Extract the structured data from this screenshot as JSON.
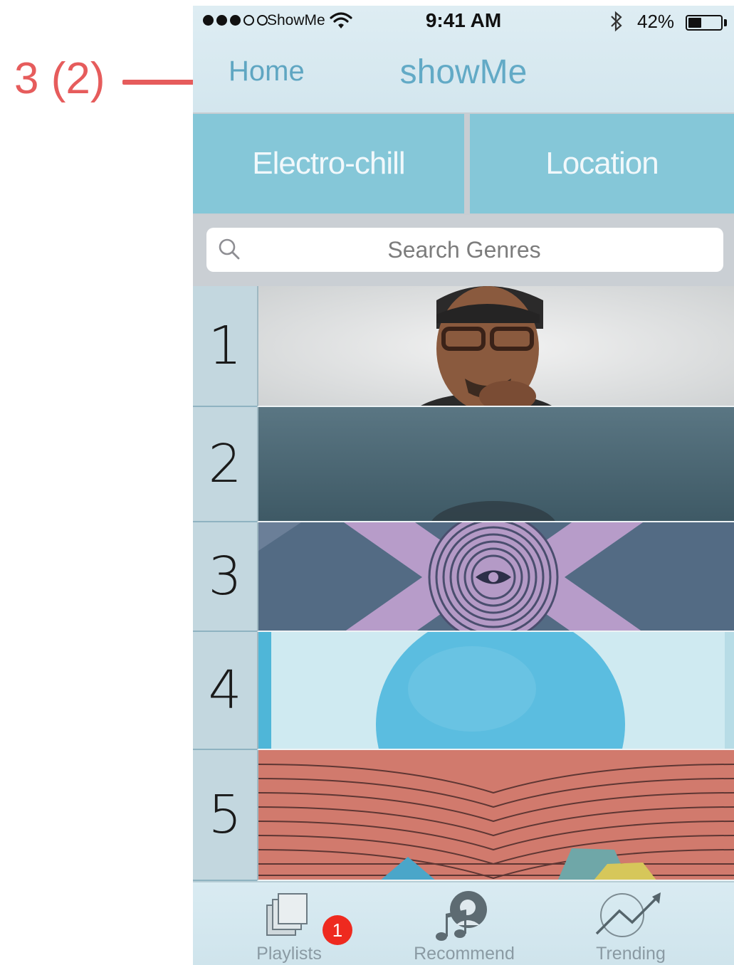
{
  "annotation": {
    "label": "3 (2)",
    "color": "#e65c5c"
  },
  "status_bar": {
    "carrier": "ShowMe",
    "time": "9:41 AM",
    "battery": "42%",
    "battery_level": 0.42
  },
  "nav": {
    "home_label": "Home",
    "title": "showMe"
  },
  "filters": [
    {
      "label": "Electro-chill"
    },
    {
      "label": "Location"
    }
  ],
  "search": {
    "placeholder": "Search Genres",
    "value": ""
  },
  "list": [
    {
      "rank": "1"
    },
    {
      "rank": "2"
    },
    {
      "rank": "3"
    },
    {
      "rank": "4"
    },
    {
      "rank": "5"
    }
  ],
  "tabs": [
    {
      "label": "Playlists",
      "icon": "playlists-icon",
      "badge": "1"
    },
    {
      "label": "Recommend",
      "icon": "recommend-icon"
    },
    {
      "label": "Trending",
      "icon": "trending-icon"
    }
  ],
  "colors": {
    "accent": "#62aac6",
    "filter_bg": "#85c7d8",
    "badge": "#ee2a1f"
  }
}
